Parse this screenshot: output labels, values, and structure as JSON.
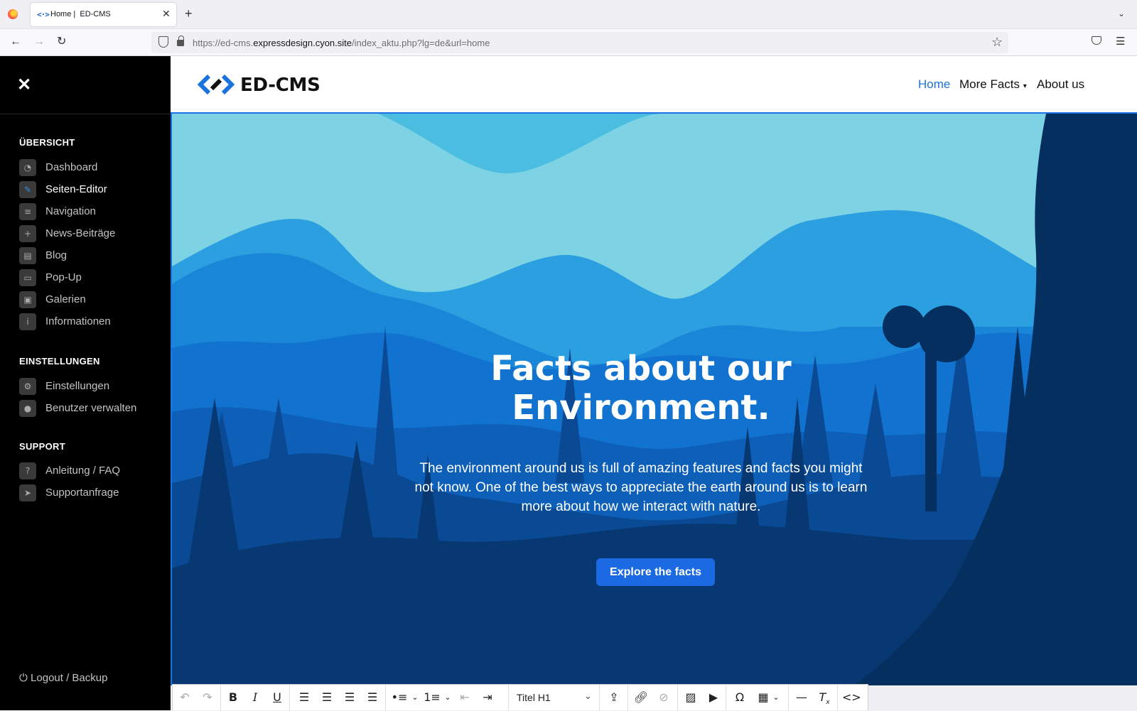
{
  "browser": {
    "tab_title": "Home |  ED-CMS",
    "tab_favicon": "<·>",
    "url_prefix": "https://ed-cms.",
    "url_domain": "expressdesign.cyon.site",
    "url_path": "/index_aktu.php?lg=de&url=home"
  },
  "sidebar": {
    "sections": [
      {
        "title": "ÜBERSICHT",
        "items": [
          {
            "label": "Dashboard",
            "icon": "dashboard-icon"
          },
          {
            "label": "Seiten-Editor",
            "icon": "edit-icon",
            "active": true
          },
          {
            "label": "Navigation",
            "icon": "menu-icon"
          },
          {
            "label": "News-Beiträge",
            "icon": "plus-icon"
          },
          {
            "label": "Blog",
            "icon": "newspaper-icon"
          },
          {
            "label": "Pop-Up",
            "icon": "popup-icon"
          },
          {
            "label": "Galerien",
            "icon": "images-icon"
          },
          {
            "label": "Informationen",
            "icon": "info-icon"
          }
        ]
      },
      {
        "title": "EINSTELLUNGEN",
        "items": [
          {
            "label": "Einstellungen",
            "icon": "gear-icon"
          },
          {
            "label": "Benutzer verwalten",
            "icon": "user-icon"
          }
        ]
      },
      {
        "title": "SUPPORT",
        "items": [
          {
            "label": "Anleitung / FAQ",
            "icon": "question-icon"
          },
          {
            "label": "Supportanfrage",
            "icon": "paper-plane-icon"
          }
        ]
      }
    ],
    "logout_label": "Logout / Backup"
  },
  "site": {
    "logo_text": "ED-CMS",
    "nav": [
      {
        "label": "Home",
        "active": true
      },
      {
        "label": "More Facts"
      },
      {
        "label": "About us"
      }
    ]
  },
  "hero": {
    "title": "Facts about our Environment.",
    "text": "The environment around us is full of amazing features and facts you might not know. One of the best ways to appreciate the earth around us is to learn more about how we interact with nature.",
    "cta_label": "Explore the facts"
  },
  "editor_toolbar": {
    "format_value": "Titel H1",
    "buttons": [
      "undo-icon",
      "redo-icon",
      "bold-icon",
      "italic-icon",
      "underline-icon",
      "align-left-icon",
      "align-center-icon",
      "align-right-icon",
      "align-justify-icon",
      "bullet-list-icon",
      "numbered-list-icon",
      "outdent-icon",
      "indent-icon",
      "upload-icon",
      "link-icon",
      "unlink-icon",
      "image-icon",
      "video-icon",
      "special-char-icon",
      "table-icon",
      "horizontal-rule-icon",
      "clear-format-icon",
      "source-code-icon"
    ]
  },
  "colors": {
    "accent": "#1b73e0",
    "sidebar_bg": "#000000",
    "hero_sky": "#7dd3e3",
    "hero_dark": "#052f5e",
    "cta": "#1b6ae3"
  }
}
